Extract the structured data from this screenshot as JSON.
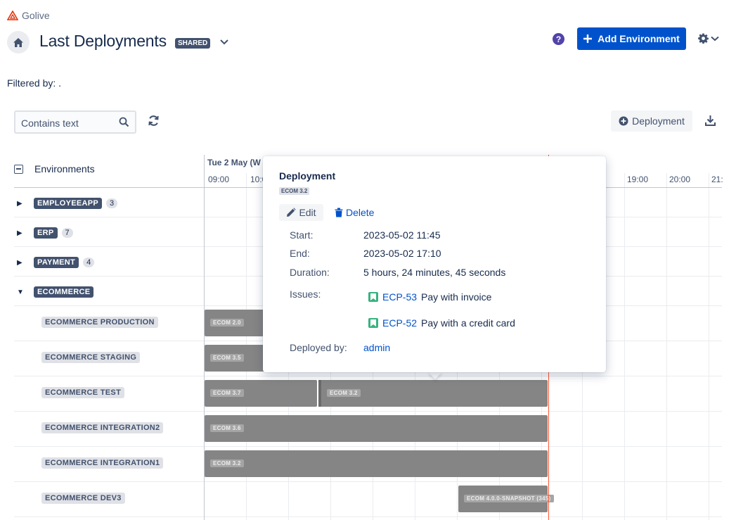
{
  "app": {
    "name": "Golive"
  },
  "header": {
    "title": "Last Deployments",
    "shared_badge": "SHARED",
    "add_env_label": "Add Environment",
    "help_glyph": "?"
  },
  "filter": {
    "label": "Filtered by: ."
  },
  "toolbar": {
    "search_placeholder": "Contains text",
    "deployment_label": "Deployment"
  },
  "timeline": {
    "env_header": "Environments",
    "date_label": "Tue 2 May (W",
    "hours": [
      "09:00",
      "10:0",
      "0",
      "19:00",
      "20:00",
      "21:"
    ]
  },
  "groups": [
    {
      "name": "EMPLOYEEAPP",
      "count": "3",
      "expanded": false
    },
    {
      "name": "ERP",
      "count": "7",
      "expanded": false
    },
    {
      "name": "PAYMENT",
      "count": "4",
      "expanded": false
    },
    {
      "name": "ECOMMERCE",
      "count": "",
      "expanded": true
    }
  ],
  "environments": [
    {
      "name": "ECOMMERCE PRODUCTION",
      "bars": [
        {
          "label": "ECOM 2.0"
        }
      ]
    },
    {
      "name": "ECOMMERCE STAGING",
      "bars": [
        {
          "label": "ECOM 3.5"
        }
      ]
    },
    {
      "name": "ECOMMERCE TEST",
      "bars": [
        {
          "label": "ECOM 3.7"
        },
        {
          "label": "ECOM 3.2"
        }
      ]
    },
    {
      "name": "ECOMMERCE INTEGRATION2",
      "bars": [
        {
          "label": "ECOM 3.6"
        }
      ]
    },
    {
      "name": "ECOMMERCE INTEGRATION1",
      "bars": [
        {
          "label": "ECOM 3.2"
        }
      ]
    },
    {
      "name": "ECOMMERCE DEV3",
      "bars": [
        {
          "label": "ECOM 4.0.0-SNAPSHOT (345)"
        }
      ]
    }
  ],
  "popup": {
    "title": "Deployment",
    "version": "ECOM 3.2",
    "edit_label": "Edit",
    "delete_label": "Delete",
    "start_label": "Start:",
    "start_value": "2023-05-02 11:45",
    "end_label": "End:",
    "end_value": "2023-05-02 17:10",
    "duration_label": "Duration:",
    "duration_value": "5 hours, 24 minutes, 45 seconds",
    "issues_label": "Issues:",
    "issues": [
      {
        "key": "ECP-53",
        "summary": "Pay with invoice"
      },
      {
        "key": "ECP-52",
        "summary": "Pay with a credit card"
      }
    ],
    "deployed_by_label": "Deployed by:",
    "deployed_by_value": "admin"
  },
  "colors": {
    "primary": "#0052cc",
    "help": "#5243aa",
    "now_line": "#ff5630",
    "bar": "#858585",
    "issue": "#36b37e"
  }
}
